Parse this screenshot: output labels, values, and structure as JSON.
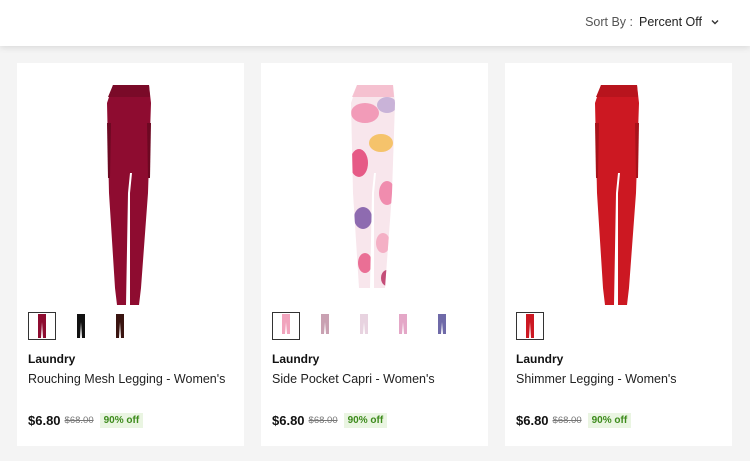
{
  "sort": {
    "prefix": "Sort By :",
    "value": "Percent Off",
    "icon": "chevron-down-icon"
  },
  "products": [
    {
      "brand": "Laundry",
      "name": "Rouching Mesh Legging - Women's",
      "price": "$6.80",
      "original_price": "$68.00",
      "discount": "90% off",
      "image_color": "#8e0c30",
      "swatches": [
        "#8e0c30",
        "#111111",
        "#3a1410"
      ]
    },
    {
      "brand": "Laundry",
      "name": "Side Pocket Capri - Women's",
      "price": "$6.80",
      "original_price": "$68.00",
      "discount": "90% off",
      "image_color": "#f1a4bd",
      "swatches": [
        "#f1a4bd",
        "#c9a1b2",
        "#e8d3e0",
        "#e4a7c7",
        "#6f6aa8"
      ]
    },
    {
      "brand": "Laundry",
      "name": "Shimmer Legging - Women's",
      "price": "$6.80",
      "original_price": "$68.00",
      "discount": "90% off",
      "image_color": "#cc1822",
      "swatches": [
        "#cc1822"
      ]
    }
  ]
}
